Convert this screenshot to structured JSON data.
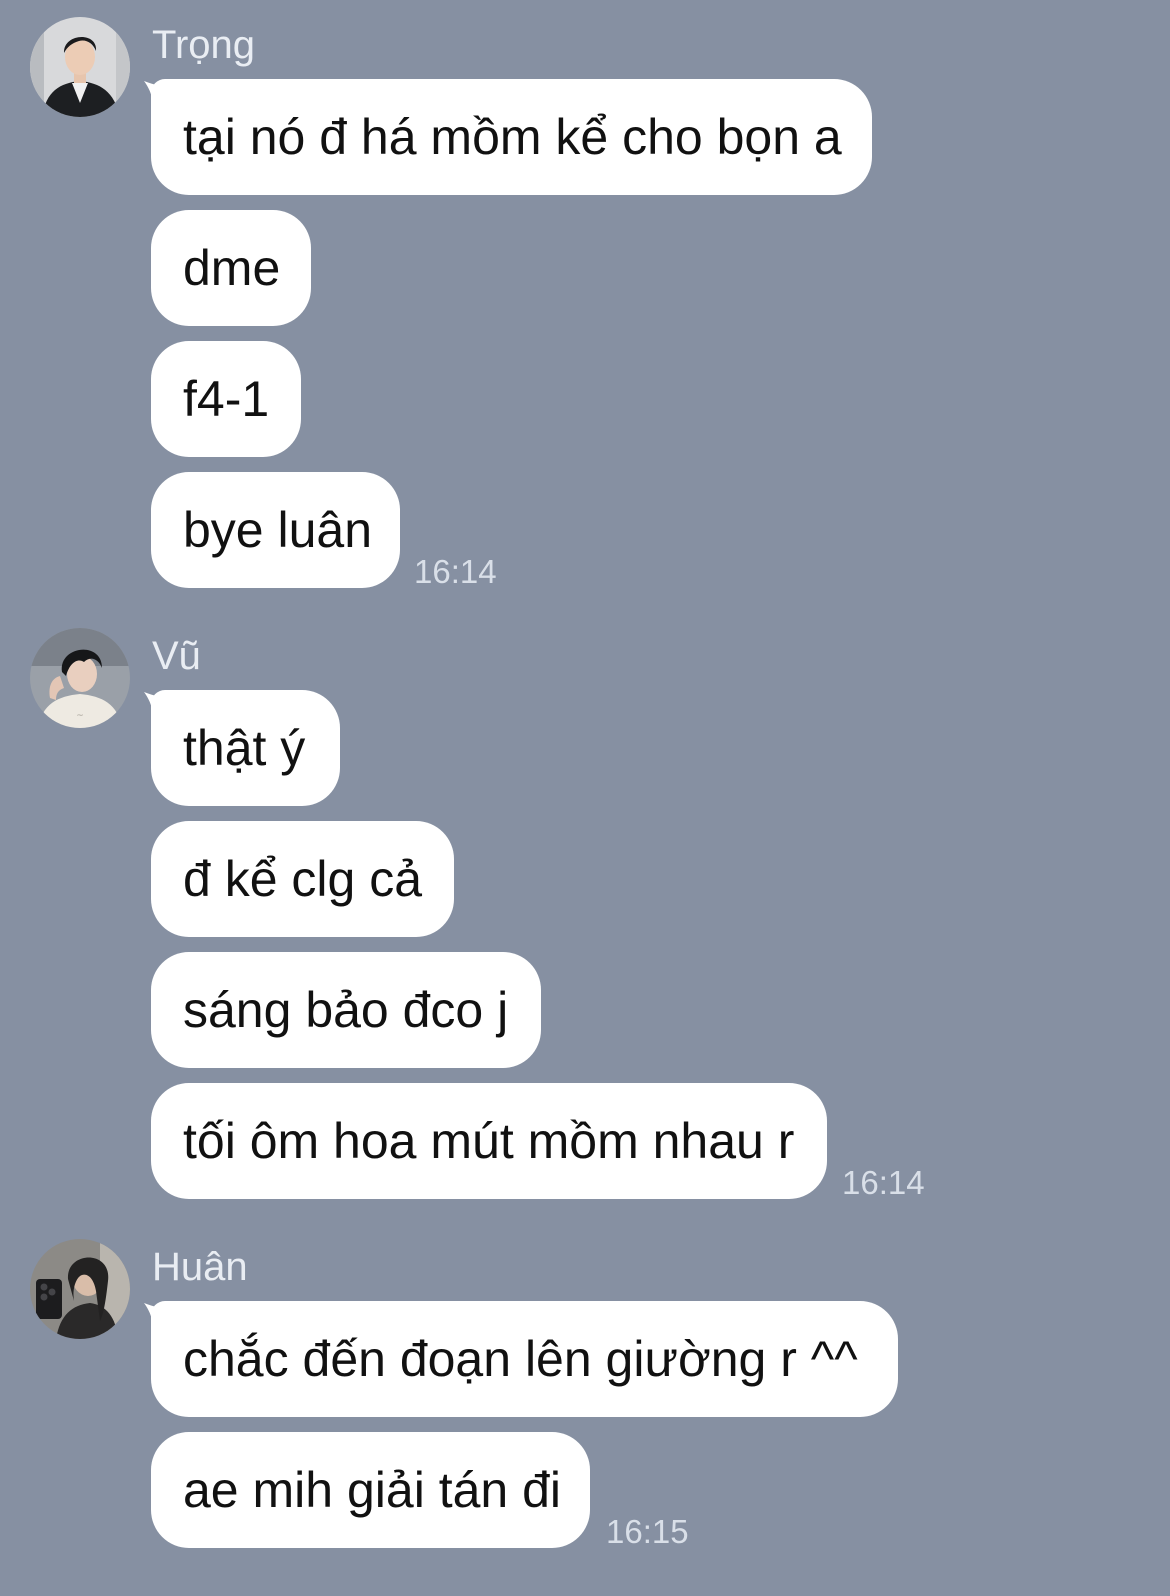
{
  "groups": [
    {
      "sender": "Trọng",
      "avatar_icon": "portrait-man-dark-suit",
      "messages": [
        "tại nó đ há mồm kể cho bọn a",
        "dme",
        "f4-1",
        "bye luân"
      ],
      "time": "16:14"
    },
    {
      "sender": "Vũ",
      "avatar_icon": "portrait-man-white-shirt",
      "messages": [
        "thật ý",
        "đ kể clg cả",
        "sáng bảo đco j",
        "tối ôm hoa mút mồm nhau r"
      ],
      "time": "16:14"
    },
    {
      "sender": "Huân",
      "avatar_icon": "portrait-man-mirror-selfie",
      "messages": [
        "chắc đến đoạn lên giường r ^^",
        "ae mih giải tán đi"
      ],
      "time": "16:15"
    }
  ],
  "colors": {
    "background": "#8690a2",
    "bubble": "#ffffff",
    "text": "#111111",
    "meta": "#d9dfe8"
  }
}
